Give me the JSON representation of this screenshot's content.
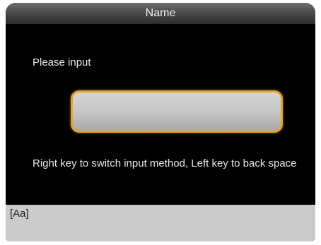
{
  "header": {
    "title": "Name"
  },
  "form": {
    "prompt": "Please input",
    "input_value": "",
    "help_text": "Right key to switch input method, Left key to back space"
  },
  "status_bar": {
    "input_mode": "[Aa]"
  },
  "colors": {
    "screen_background": "#000000",
    "input_border_accent": "#e0a52a",
    "status_bar_background": "#cbcbcb"
  }
}
